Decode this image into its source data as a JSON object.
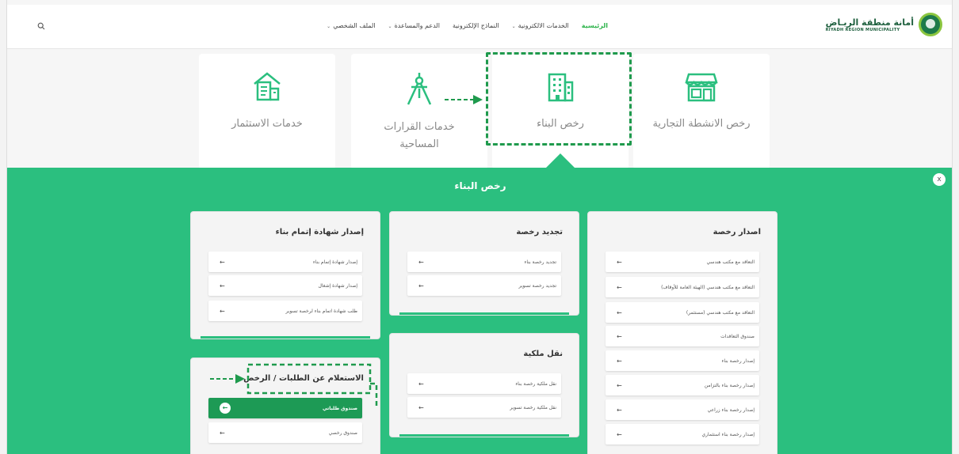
{
  "header": {
    "logo_ar": "أمانة منطقة الريـاض",
    "logo_en": "RIYADH REGION MUNICIPALITY",
    "nav": [
      {
        "label": "الرئيسية",
        "active": true,
        "dropdown": false
      },
      {
        "label": "الخدمات الالكترونية",
        "active": false,
        "dropdown": true
      },
      {
        "label": "النماذج الإلكترونية",
        "active": false,
        "dropdown": false
      },
      {
        "label": "الدعم والمساعدة",
        "active": false,
        "dropdown": true
      },
      {
        "label": "الملف الشخصي",
        "active": false,
        "dropdown": true
      }
    ],
    "search_icon": "search-icon"
  },
  "services": [
    {
      "label": "رخص الانشطة التجارية",
      "icon": "store-icon"
    },
    {
      "label": "رخص البناء",
      "icon": "building-icon"
    },
    {
      "label": "خدمات القرارات المساحية",
      "icon": "compass-icon"
    },
    {
      "label": "خدمات الاستثمار",
      "icon": "investment-icon"
    }
  ],
  "panel": {
    "title": "رخص البناء",
    "close_label": "x",
    "groups": {
      "issue": {
        "title": "اصدار رخصة",
        "items": [
          "التعاقد مع مكتب هندسي",
          "التعاقد مع مكتب هندسي (الهيئة العامة للأوقاف)",
          "التعاقد مع مكتب هندسي (مستثمر)",
          "صندوق التعاقدات",
          "إصدار رخصة بناء",
          "إصدار رخصة بناء بالتزامن",
          "إصدار رخصة بناء زراعي",
          "إصدار رخصة بناء استثماري"
        ]
      },
      "renew": {
        "title": "تجديد رخصة",
        "items": [
          "تجديد رخصة بناء",
          "تجديد رخصة تسوير"
        ]
      },
      "transfer": {
        "title": "نقل ملكية",
        "items": [
          "نقل ملكية رخصة بناء",
          "نقل ملكية رخصة تسوير"
        ]
      },
      "completion": {
        "title": "إصدار شهادة إتمام بناء",
        "items": [
          "إصدار شهادة إتمام بناء",
          "إصدار شهادة إشغال",
          "طلب شهادة اتمام بناء لرخصة تسوير"
        ]
      },
      "inquiry": {
        "title": "الاستعلام عن الطلبات / الرخص",
        "items": [
          "صندوق طلباتي",
          "صندوق رخصي"
        ]
      }
    }
  },
  "colors": {
    "brand_green": "#2bbf7f",
    "selected_green": "#1d9a55",
    "dash_green": "#1f9a4d",
    "nav_active": "#2cb34a"
  },
  "arrow_icon": "arrow-left-icon"
}
